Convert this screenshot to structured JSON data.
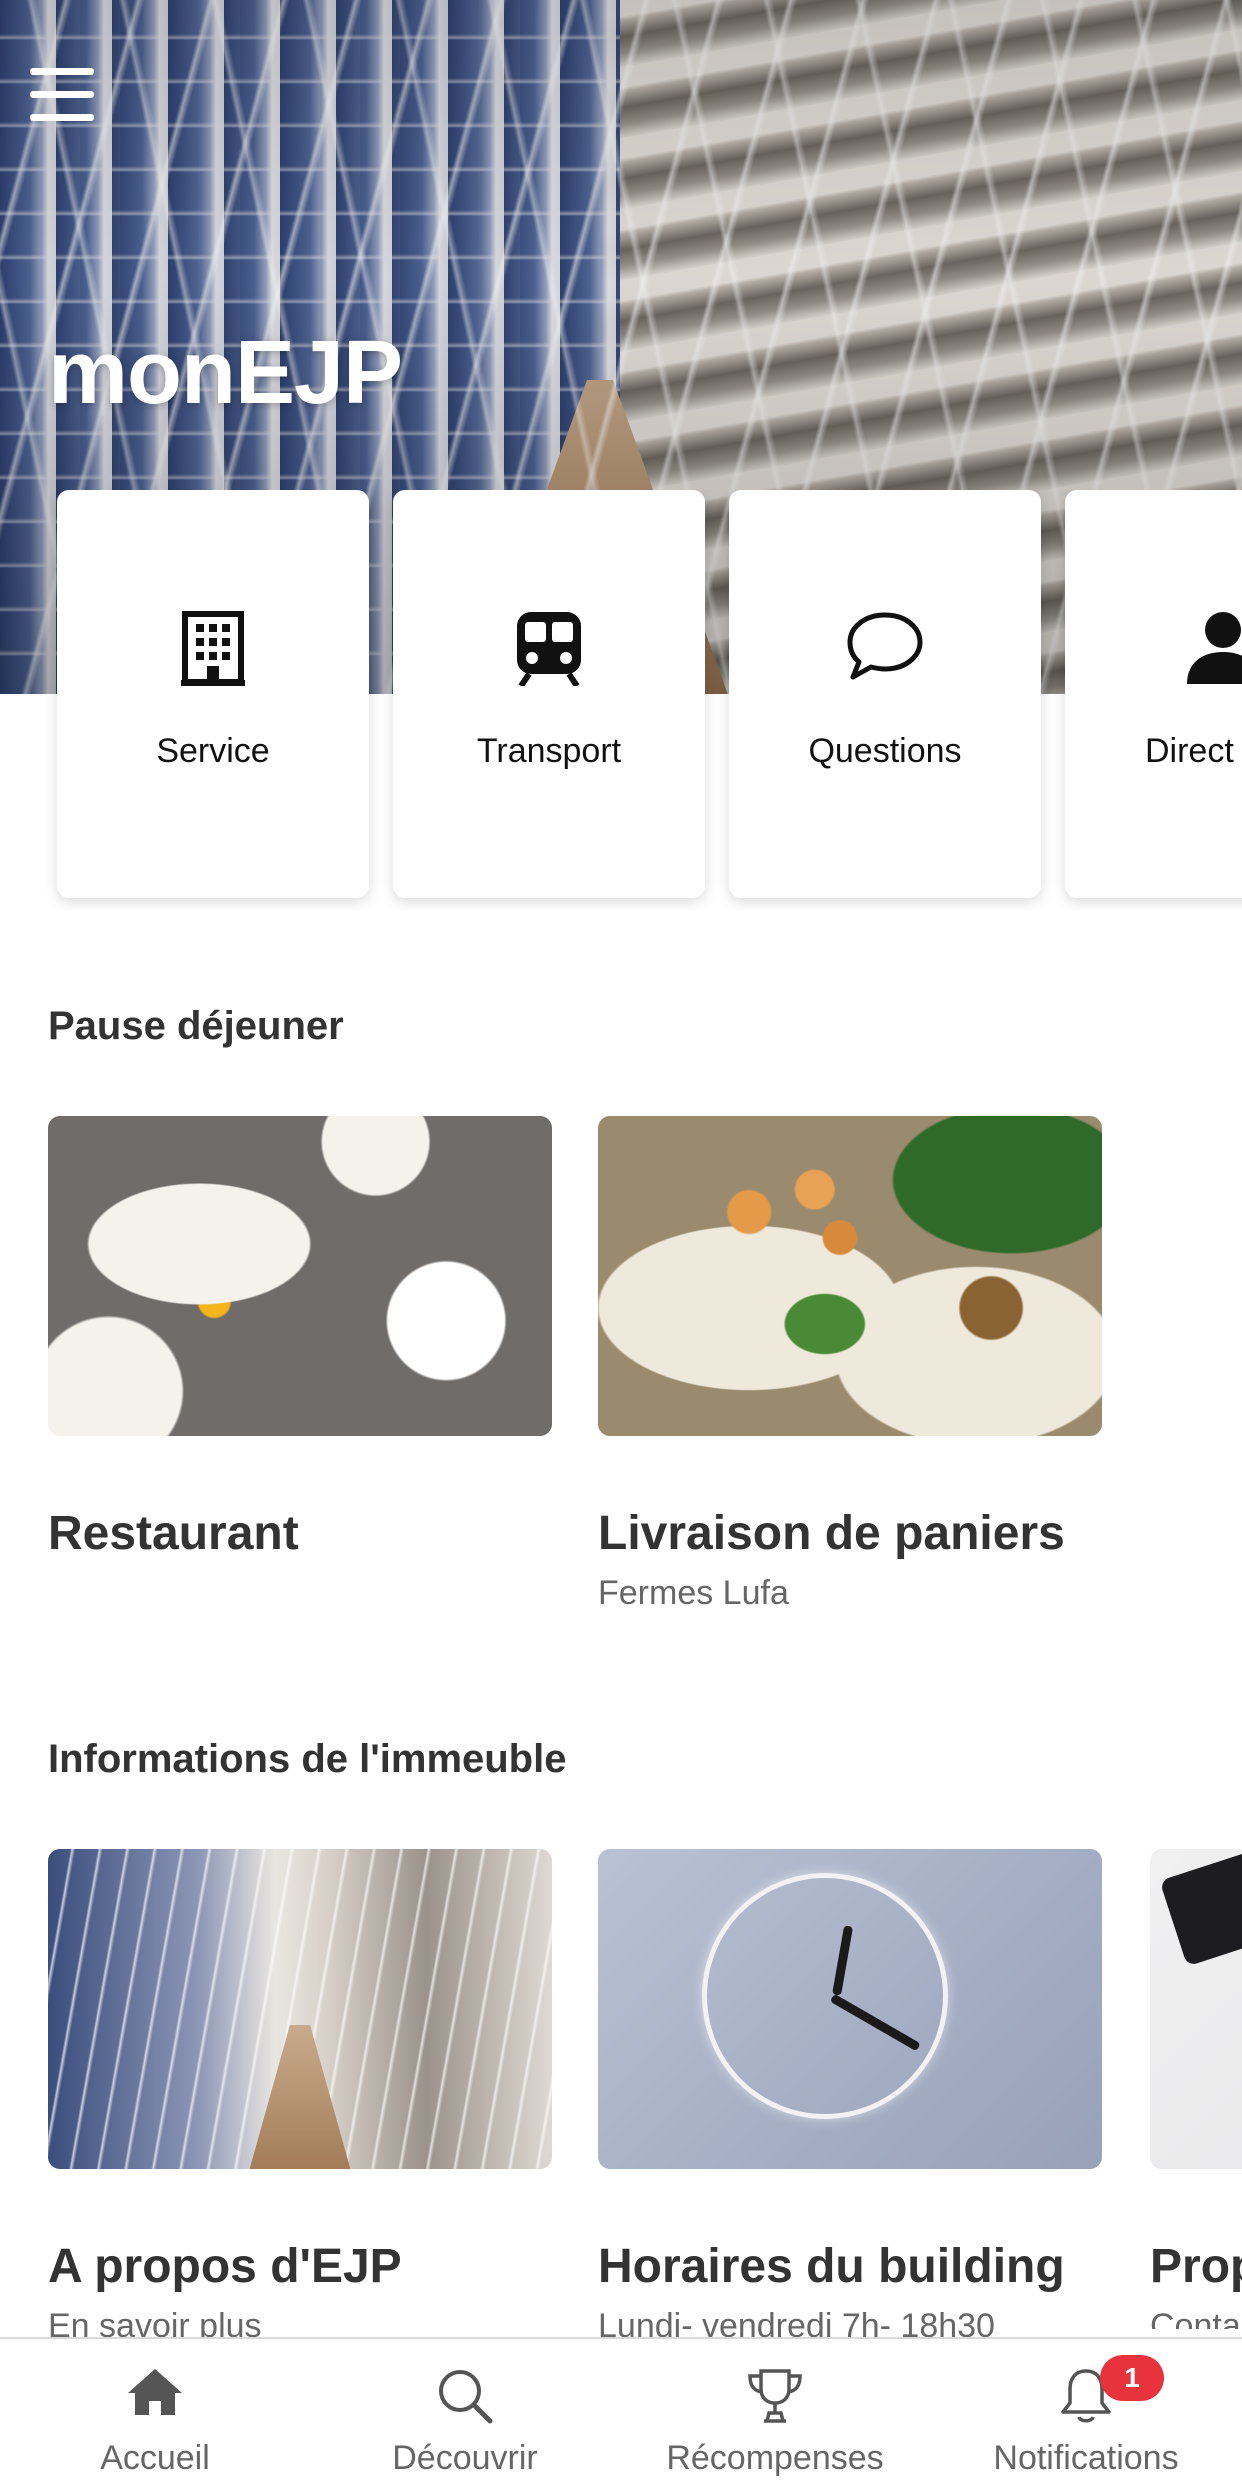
{
  "app": {
    "title": "monEJP"
  },
  "shortcuts": [
    {
      "label": "Service",
      "icon": "building-icon"
    },
    {
      "label": "Transport",
      "icon": "train-icon"
    },
    {
      "label": "Questions",
      "icon": "chat-bubble-icon"
    },
    {
      "label": "Direct",
      "icon": "person-icon"
    }
  ],
  "lunch": {
    "title": "Pause déjeuner",
    "items": [
      {
        "title": "Restaurant",
        "subtitle": ""
      },
      {
        "title": "Livraison de paniers",
        "subtitle": "Fermes Lufa"
      }
    ]
  },
  "building": {
    "title": "Informations de l'immeuble",
    "items": [
      {
        "title": "A propos d'EJP",
        "subtitle": "En savoir plus"
      },
      {
        "title": "Horaires du building",
        "subtitle": "Lundi- vendredi 7h- 18h30"
      },
      {
        "title": "Prop",
        "subtitle": "Conta"
      }
    ]
  },
  "tabbar": {
    "tabs": [
      {
        "label": "Accueil",
        "icon": "home-icon",
        "active": true
      },
      {
        "label": "Découvrir",
        "icon": "search-icon"
      },
      {
        "label": "Récompenses",
        "icon": "trophy-icon"
      },
      {
        "label": "Notifications",
        "icon": "bell-icon",
        "badge": "1"
      }
    ]
  },
  "colors": {
    "badge": "#e8323c",
    "text": "#333333",
    "muted": "#666666"
  }
}
